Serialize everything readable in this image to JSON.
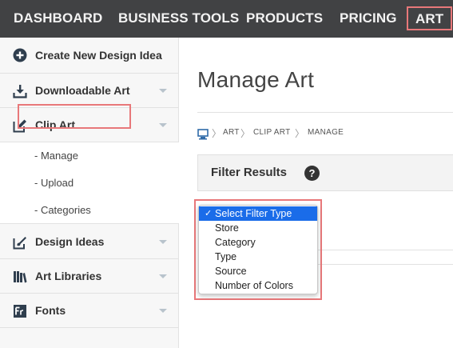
{
  "topnav": {
    "items": [
      {
        "label": "DASHBOARD"
      },
      {
        "label": "BUSINESS TOOLS"
      },
      {
        "label": "PRODUCTS"
      },
      {
        "label": "PRICING"
      },
      {
        "label": "ART"
      }
    ]
  },
  "sidebar": {
    "items": [
      {
        "label": "Create New Design Idea",
        "icon": "plus-circle-icon"
      },
      {
        "label": "Downloadable Art",
        "icon": "download-icon"
      },
      {
        "label": "Clip Art",
        "icon": "pencil-edit-icon"
      },
      {
        "label": "Design Ideas",
        "icon": "paint-brush-icon"
      },
      {
        "label": "Art Libraries",
        "icon": "books-icon"
      },
      {
        "label": "Fonts",
        "icon": "fonts-icon"
      }
    ],
    "clip_art_sub": [
      {
        "label": "- Manage"
      },
      {
        "label": "- Upload"
      },
      {
        "label": "- Categories"
      }
    ]
  },
  "main": {
    "title": "Manage Art",
    "breadcrumb": [
      "ART",
      "CLIP ART",
      "MANAGE"
    ],
    "filter_title": "Filter Results",
    "help_glyph": "?"
  },
  "filter_dropdown": {
    "options": [
      "Select Filter Type",
      "Store",
      "Category",
      "Type",
      "Source",
      "Number of Colors"
    ],
    "selected": "Select Filter Type",
    "check": "✓"
  },
  "colors": {
    "nav_bg": "#414244",
    "highlight": "#e8787a",
    "select_blue": "#1a6ce9"
  }
}
